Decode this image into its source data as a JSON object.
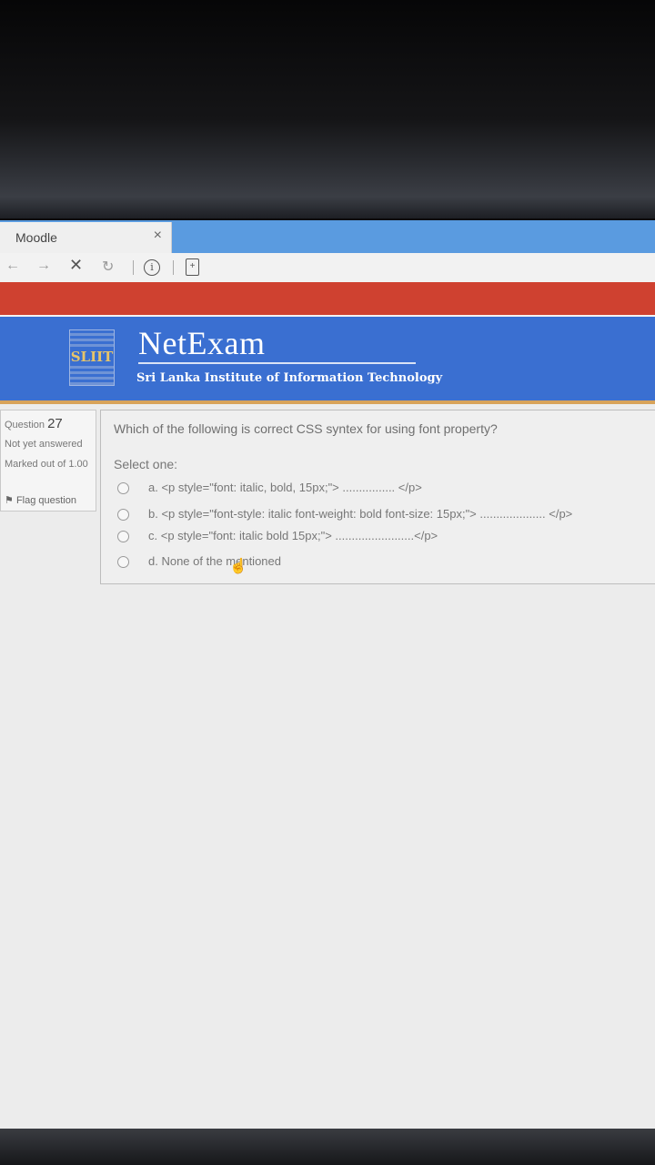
{
  "browser": {
    "tab_title": "Moodle",
    "tab_close": "×",
    "toolbar": {
      "back": "←",
      "forward": "→",
      "stop": "✕",
      "reload": "↻",
      "info": "i",
      "page": "+"
    }
  },
  "site": {
    "logo_text": "SLIIT",
    "name": "NetExam",
    "subtitle": "Sri Lanka Institute of Information Technology"
  },
  "question_info": {
    "label": "Question",
    "number": "27",
    "status": "Not yet answered",
    "marks": "Marked out of 1.00",
    "flag_icon": "⚑",
    "flag_label": "Flag question"
  },
  "question": {
    "text": "Which of the following is correct CSS syntex for using font property?",
    "select_label": "Select one:",
    "options": [
      {
        "label": "a. <p style=\"font: italic, bold, 15px;\"> ................ </p>"
      },
      {
        "label": "b. <p style=\"font-style: italic font-weight: bold font-size: 15px;\"> .................... </p>"
      },
      {
        "label": "c. <p style=\"font: italic bold 15px;\"> ........................</p>"
      },
      {
        "label": "d. None of the mentioned"
      }
    ]
  },
  "cursor_icon": "☝"
}
